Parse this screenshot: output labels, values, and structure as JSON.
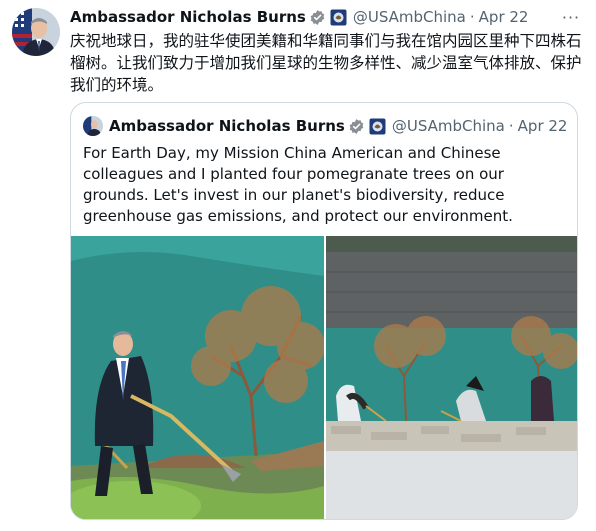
{
  "tweet": {
    "author_name": "Ambassador Nicholas Burns",
    "handle": "@USAmbChina",
    "separator": "·",
    "date": "Apr 22",
    "more_label": "···",
    "text": "庆祝地球日，我的驻华使团美籍和华籍同事们与我在馆内园区里种下四株石榴树。让我们致力于增加我们星球的生物多样性、减少温室气体排放、保护我们的环境。",
    "icons": [
      "verified-badge-icon",
      "government-affiliation-icon",
      "more-options-icon"
    ]
  },
  "quote": {
    "author_name": "Ambassador Nicholas Burns",
    "handle": "@USAmbChina",
    "separator": "·",
    "date": "Apr 22",
    "text": "For Earth Day, my Mission China American and Chinese colleagues and I planted four pomegranate trees on our grounds.  Let's invest in our planet's biodiversity, reduce greenhouse gas emissions, and protect our environment.",
    "photos": [
      "ambassador-planting-tree-photo",
      "staff-planting-trees-photo"
    ]
  },
  "colors": {
    "text_primary": "#0f1419",
    "text_secondary": "#536471",
    "verified_blue": "#1d9bf0",
    "border": "#cfd9de"
  }
}
